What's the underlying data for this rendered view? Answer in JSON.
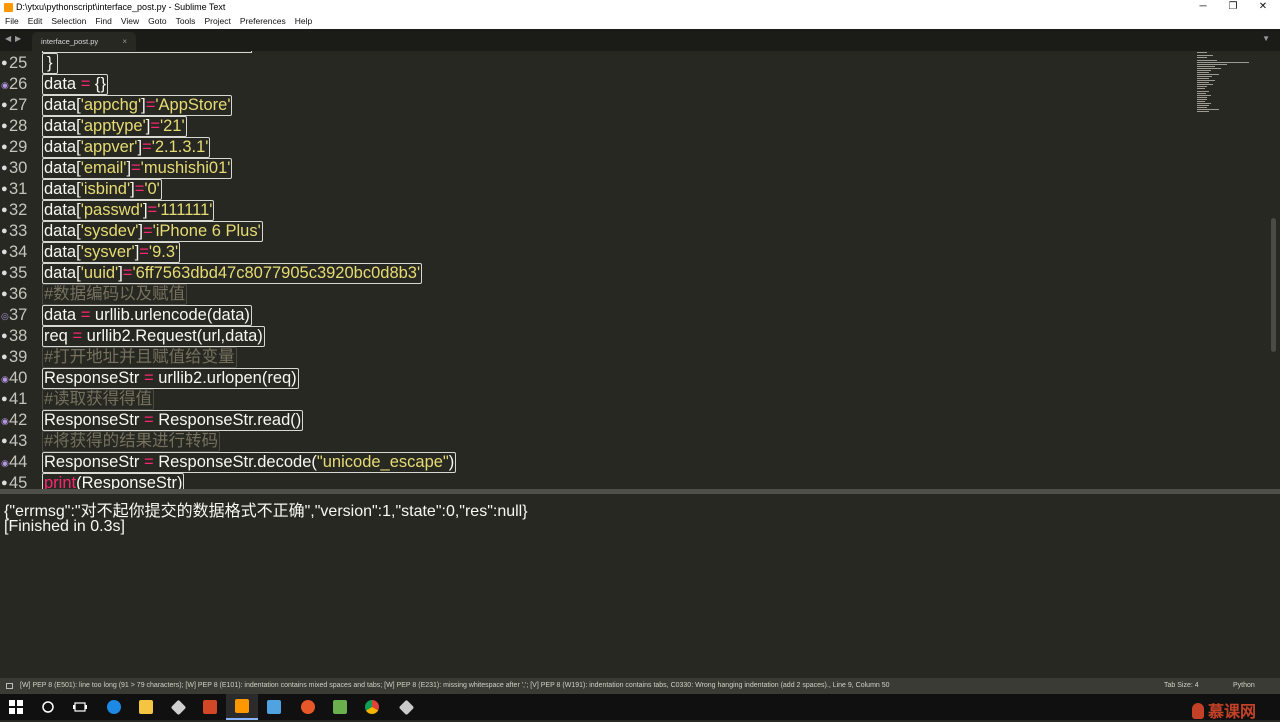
{
  "window": {
    "title": "D:\\ytxu\\pythonscript\\interface_post.py - Sublime Text",
    "minimize": "─",
    "restore": "❐",
    "close": "✕"
  },
  "menu": [
    "File",
    "Edit",
    "Selection",
    "Find",
    "View",
    "Goto",
    "Tools",
    "Project",
    "Preferences",
    "Help"
  ],
  "tabs": {
    "nav_left": "◀",
    "nav_right": "▶",
    "active_file": "interface_post.py",
    "close": "×",
    "dropdown": "▼"
  },
  "gutter": {
    "line_numbers": [
      "25",
      "26",
      "27",
      "28",
      "29",
      "30",
      "31",
      "32",
      "33",
      "34",
      "35",
      "36",
      "37",
      "38",
      "39",
      "40",
      "41",
      "42",
      "43",
      "44",
      "45"
    ]
  },
  "code": {
    "l25": [
      "}"
    ],
    "l26": [
      "data ",
      "=",
      " {}"
    ],
    "l27": [
      "data[",
      "'appchg'",
      "]",
      "=",
      "'AppStore'"
    ],
    "l28": [
      "data[",
      "'apptype'",
      "]",
      "=",
      "'21'"
    ],
    "l29": [
      "data[",
      "'appver'",
      "]",
      "=",
      "'2.1.3.1'"
    ],
    "l30": [
      "data[",
      "'email'",
      "]",
      "=",
      "'mushishi01'"
    ],
    "l31": [
      "data[",
      "'isbind'",
      "]",
      "=",
      "'0'"
    ],
    "l32": [
      "data[",
      "'passwd'",
      "]",
      "=",
      "'111111'"
    ],
    "l33": [
      "data[",
      "'sysdev'",
      "]",
      "=",
      "'iPhone 6 Plus'"
    ],
    "l34": [
      "data[",
      "'sysver'",
      "]",
      "=",
      "'9.3'"
    ],
    "l35": [
      "data[",
      "'uuid'",
      "]",
      "=",
      "'6ff7563dbd47c8077905c3920bc0d8b3'"
    ],
    "l36": [
      "#数据编码以及赋值"
    ],
    "l37": [
      "data ",
      "=",
      " urllib.urlencode(data)"
    ],
    "l38": [
      "req ",
      "=",
      " urllib2.Request(url,data)"
    ],
    "l39": [
      "#打开地址并且赋值给变量"
    ],
    "l40": [
      "ResponseStr ",
      "=",
      " urllib2.urlopen(req)"
    ],
    "l41": [
      "#读取获得得值"
    ],
    "l42": [
      "ResponseStr ",
      "=",
      " ResponseStr.read()"
    ],
    "l43": [
      "#将获得的结果进行转码"
    ],
    "l44": [
      "ResponseStr ",
      "=",
      " ResponseStr.decode(",
      "\"unicode_escape\"",
      ")"
    ],
    "l45": [
      "print",
      "(ResponseStr)"
    ]
  },
  "output": {
    "line1": "{\"errmsg\":\"对不起你提交的数据格式不正确\",\"version\":1,\"state\":0,\"res\":null}",
    "line2": "[Finished in 0.3s]"
  },
  "status": {
    "message": "[W] PEP 8 (E501): line too long (91 > 79 characters); [W] PEP 8 (E101): indentation contains mixed spaces and tabs; [W] PEP 8 (E231): missing whitespace after ','; [V] PEP 8 (W191): indentation contains tabs, C0330: Wrong hanging indentation (add 2 spaces)., Line 9, Column 50",
    "tab_size": "Tab Size: 4",
    "syntax": "Python"
  },
  "watermark": "慕课网",
  "colors": {
    "editor_bg": "#272822",
    "string": "#e6db74",
    "operator": "#f92672",
    "comment": "#75715e"
  }
}
